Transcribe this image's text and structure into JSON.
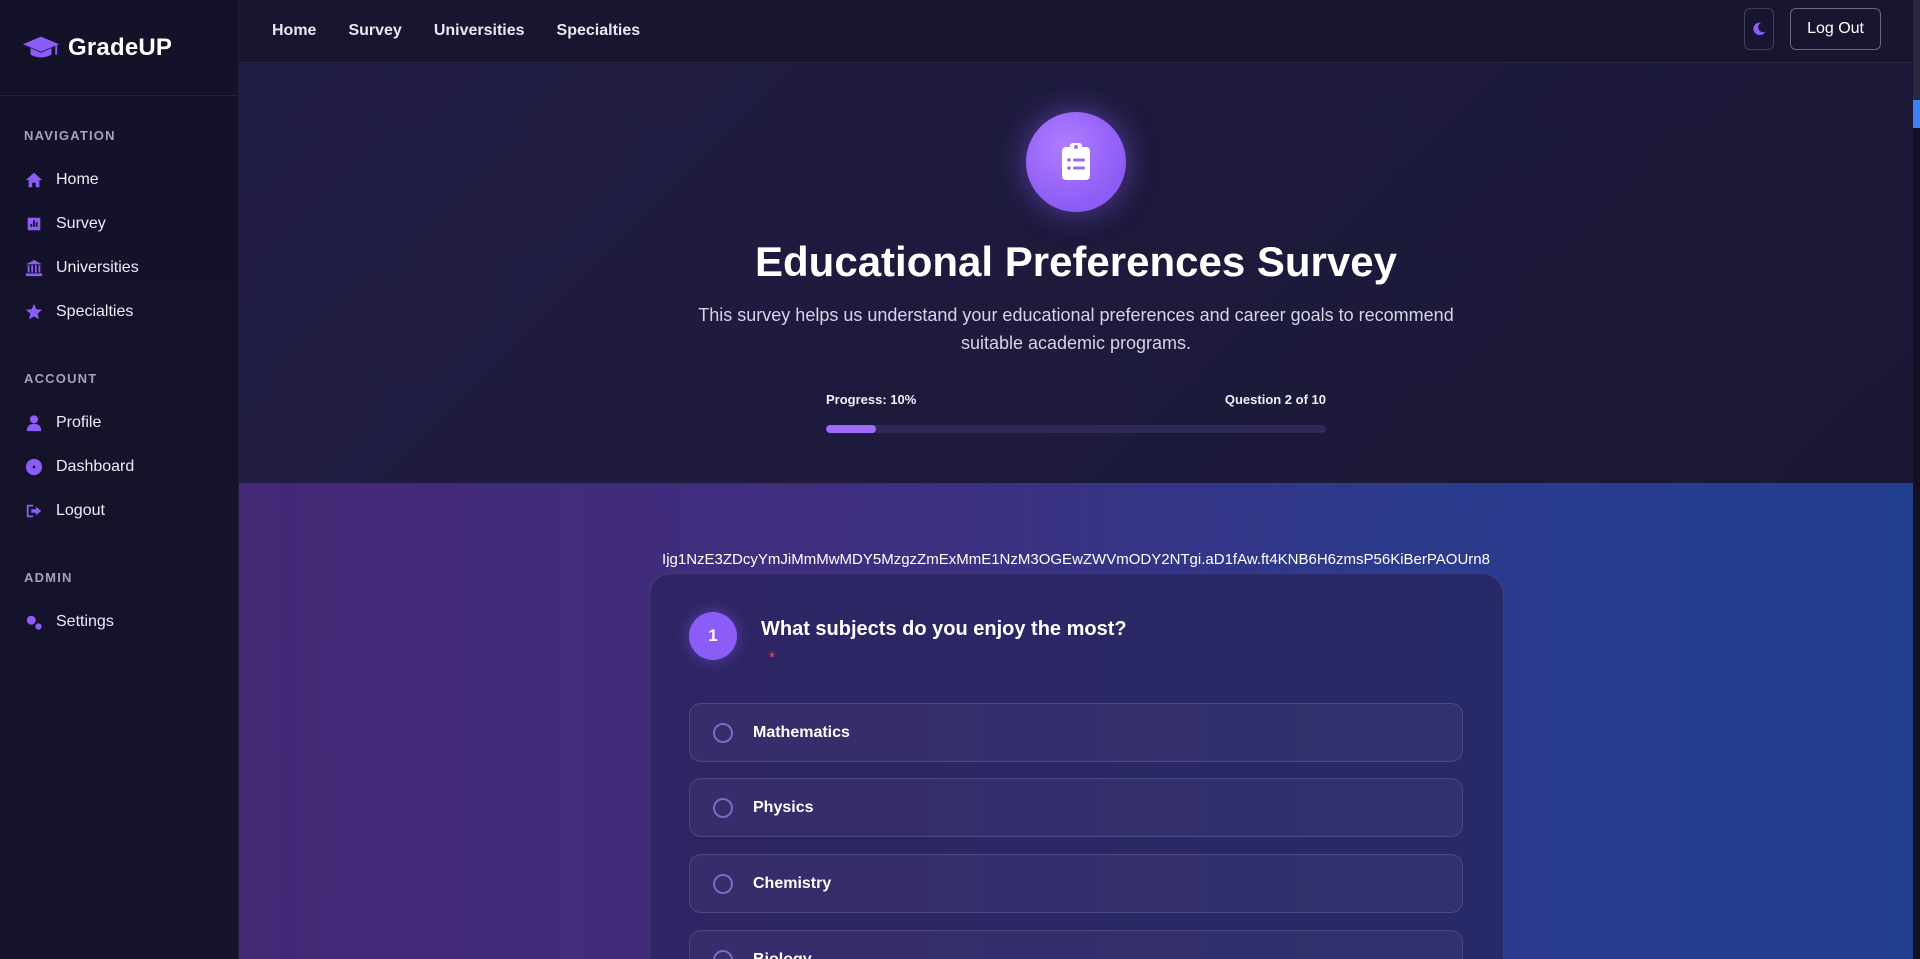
{
  "brand": {
    "name": "GradeUP",
    "icon": "graduation-cap-icon"
  },
  "sidebar": {
    "sections": [
      {
        "title": "NAVIGATION",
        "items": [
          {
            "label": "Home",
            "icon": "home-icon"
          },
          {
            "label": "Survey",
            "icon": "chart-icon"
          },
          {
            "label": "Universities",
            "icon": "university-icon"
          },
          {
            "label": "Specialties",
            "icon": "star-icon"
          }
        ]
      },
      {
        "title": "ACCOUNT",
        "items": [
          {
            "label": "Profile",
            "icon": "user-icon"
          },
          {
            "label": "Dashboard",
            "icon": "dashboard-icon"
          },
          {
            "label": "Logout",
            "icon": "logout-icon"
          }
        ]
      },
      {
        "title": "ADMIN",
        "items": [
          {
            "label": "Settings",
            "icon": "gears-icon"
          }
        ]
      }
    ]
  },
  "topbar": {
    "links": [
      "Home",
      "Survey",
      "Universities",
      "Specialties"
    ],
    "theme_icon": "moon-icon",
    "logout_label": "Log Out"
  },
  "hero": {
    "icon": "clipboard-list-icon",
    "title": "Educational Preferences Survey",
    "description": "This survey helps us understand your educational preferences and career goals to recommend suitable academic programs.",
    "progress_label": "Progress: 10%",
    "question_label": "Question 2 of 10",
    "progress_value": 0.1
  },
  "main": {
    "token": "Ijg1NzE3ZDcyYmJiMmMwMDY5MzgzZmExMmE1NzM3OGEwZWVmODY2NTgi.aD1fAw.ft4KNB6H6zmsP56KiBerPAOUrn8",
    "question": {
      "number": "1",
      "text": "What subjects do you enjoy the most?",
      "required_mark": "*",
      "options": [
        "Mathematics",
        "Physics",
        "Chemistry",
        "Biology"
      ]
    }
  },
  "colors": {
    "accent": "#8b5cf6",
    "background": "#181634",
    "required": "#e2556b"
  }
}
